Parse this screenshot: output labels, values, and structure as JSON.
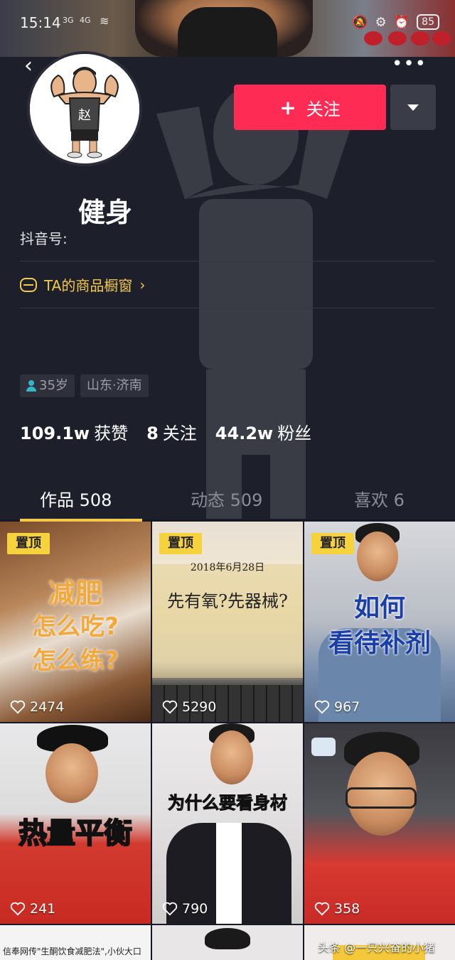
{
  "status_bar": {
    "time": "15:14",
    "net1": "3G",
    "net2": "4G",
    "battery": "85"
  },
  "profile": {
    "follow_label": "关注",
    "name": "健身",
    "douyin_id_label": "抖音号:",
    "shop_label": "TA的商品橱窗",
    "tags": [
      "35岁",
      "山东·济南"
    ],
    "stats": [
      {
        "value": "109.1w",
        "label": "获赞"
      },
      {
        "value": "8",
        "label": "关注"
      },
      {
        "value": "44.2w",
        "label": "粉丝"
      }
    ]
  },
  "tabs": [
    {
      "label": "作品 508"
    },
    {
      "label": "动态 509"
    },
    {
      "label": "喜欢 6"
    }
  ],
  "videos": [
    {
      "pinned": "置顶",
      "caption_lines": [
        "减肥",
        "怎么吃?",
        "怎么练?"
      ],
      "likes": "2474"
    },
    {
      "pinned": "置顶",
      "caption_lines": [
        "2018年6月28日",
        "先有氧?先器械?"
      ],
      "likes": "5290"
    },
    {
      "pinned": "置顶",
      "caption_lines": [
        "如何",
        "看待补剂"
      ],
      "likes": "967"
    },
    {
      "caption_lines": [
        "热量平衡"
      ],
      "likes": "241"
    },
    {
      "caption_lines": [
        "为什么要看身材"
      ],
      "likes": "790"
    },
    {
      "likes": "358"
    }
  ],
  "partial_row": {
    "text": "信奉网传\"生酮饮食减肥法\",小伙大口"
  },
  "watermark": "头条 @一只兴奋的小猪",
  "colors": {
    "accent": "#fe2c55",
    "pin": "#f6d23d",
    "gold": "#f2c94c",
    "bg": "#1d1f2b"
  }
}
